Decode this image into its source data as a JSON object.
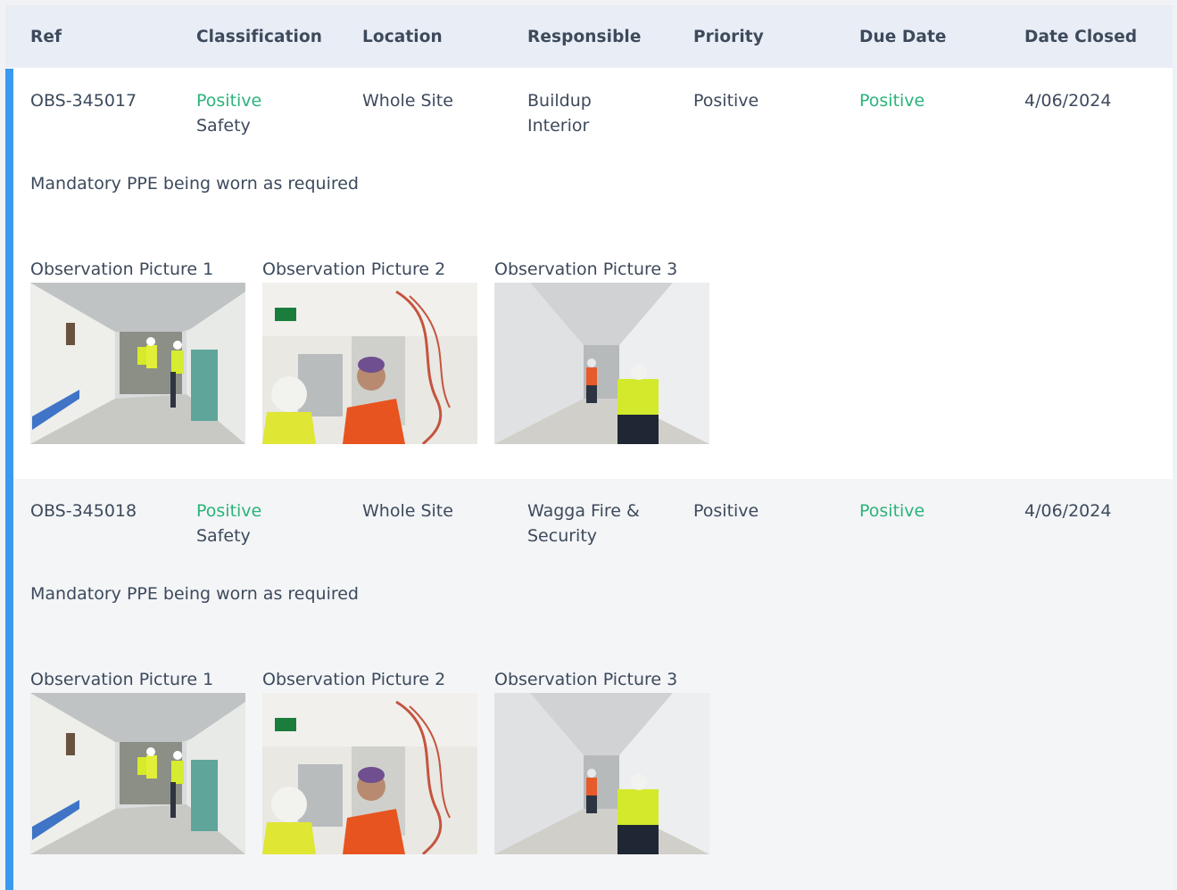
{
  "table": {
    "headers": [
      "Ref",
      "Classification",
      "Location",
      "Responsible",
      "Priority",
      "Due Date",
      "Date Closed"
    ],
    "rows": [
      {
        "ref": "OBS-345017",
        "classification_line1": "Positive",
        "classification_line2": "Safety",
        "location": "Whole Site",
        "responsible_line1": "Buildup",
        "responsible_line2": "Interior",
        "priority": "Positive",
        "due_date": "Positive",
        "date_closed": "4/06/2024",
        "description": "Mandatory PPE being worn as required",
        "pictures": [
          "Observation Picture 1",
          "Observation Picture 2",
          "Observation Picture 3"
        ]
      },
      {
        "ref": "OBS-345018",
        "classification_line1": "Positive",
        "classification_line2": "Safety",
        "location": "Whole Site",
        "responsible_line1": "Wagga Fire &",
        "responsible_line2": "Security",
        "priority": "Positive",
        "due_date": "Positive",
        "date_closed": "4/06/2024",
        "description": "Mandatory PPE being worn as required",
        "pictures": [
          "Observation Picture 1",
          "Observation Picture 2",
          "Observation Picture 3"
        ]
      }
    ]
  },
  "colors": {
    "accent": "#3a9af0",
    "positive": "#2ab37a",
    "header_bg": "#e9eef6",
    "text": "#3d4a5c"
  }
}
